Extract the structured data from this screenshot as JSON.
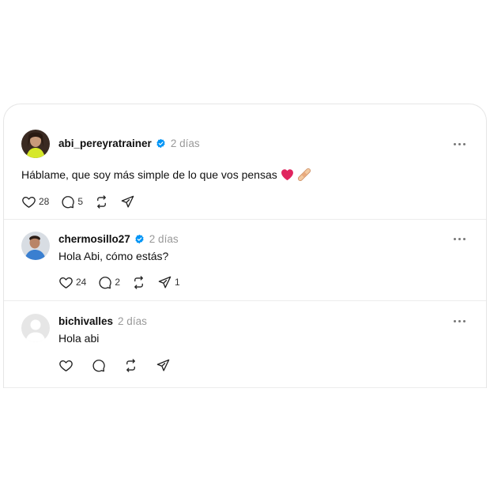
{
  "posts": [
    {
      "username": "abi_pereyratrainer",
      "verified": true,
      "time": "2 días",
      "text": "Háblame, que soy más simple de lo que vos pensas",
      "emoji": [
        "red-heart-icon",
        "bandage-icon"
      ],
      "likes": "28",
      "replies": "5",
      "reposts": "",
      "shares": ""
    },
    {
      "username": "chermosillo27",
      "verified": true,
      "time": "2 días",
      "text": "Hola Abi, cómo estás?",
      "likes": "24",
      "replies": "2",
      "reposts": "",
      "shares": "1"
    },
    {
      "username": "bichivalles",
      "verified": false,
      "time": "2 días",
      "text": "Hola abi",
      "likes": "",
      "replies": "",
      "reposts": "",
      "shares": ""
    }
  ],
  "colors": {
    "verified": "#0095f6",
    "heart": "#e0245e",
    "muted": "#999999"
  }
}
